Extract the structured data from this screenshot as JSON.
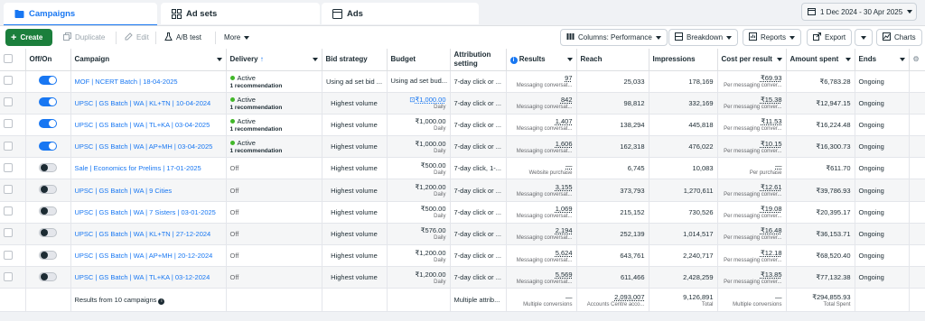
{
  "tabs": [
    {
      "label": "Campaigns",
      "icon": "folder-icon"
    },
    {
      "label": "Ad sets",
      "icon": "grid-icon"
    },
    {
      "label": "Ads",
      "icon": "ad-icon"
    }
  ],
  "date_range": "1 Dec 2024 - 30 Apr 2025",
  "toolbar": {
    "create": "Create",
    "duplicate": "Duplicate",
    "edit": "Edit",
    "ab_test": "A/B test",
    "more": "More",
    "columns": "Columns: Performance",
    "breakdown": "Breakdown",
    "reports": "Reports",
    "export": "Export",
    "charts": "Charts"
  },
  "columns": [
    "Off/On",
    "Campaign",
    "Delivery",
    "Bid strategy",
    "Budget",
    "Attribution setting",
    "Results",
    "Reach",
    "Impressions",
    "Cost per result",
    "Amount spent",
    "Ends"
  ],
  "rows": [
    {
      "on": true,
      "campaign": "MOF | NCERT Batch | 18-04-2025",
      "delivery": "Active",
      "rec": "1 recommendation",
      "bid": "Using ad set bid ...",
      "budget": "Using ad set bud...",
      "budget_sub": "",
      "attr": "7-day click or ...",
      "results": "97",
      "results_sub": "Messaging conversat...",
      "reach": "25,033",
      "impr": "178,169",
      "cpr": "₹69.93",
      "cpr_sub": "Per messaging conver...",
      "spent": "₹6,783.28",
      "ends": "Ongoing"
    },
    {
      "on": true,
      "campaign": "UPSC | GS Batch | WA | KL+TN | 10-04-2024",
      "delivery": "Active",
      "rec": "1 recommendation",
      "bid": "Highest volume",
      "budget": "₹1,000.00",
      "budget_sub": "Daily",
      "attr": "7-day click or ...",
      "results": "842",
      "results_sub": "Messaging conversat...",
      "reach": "98,812",
      "impr": "332,169",
      "cpr": "₹15.38",
      "cpr_sub": "Per messaging conver...",
      "spent": "₹12,947.15",
      "ends": "Ongoing"
    },
    {
      "on": true,
      "campaign": "UPSC | GS Batch | WA | TL+KA | 03-04-2025",
      "delivery": "Active",
      "rec": "1 recommendation",
      "bid": "Highest volume",
      "budget": "₹1,000.00",
      "budget_sub": "Daily",
      "attr": "7-day click or ...",
      "results": "1,407",
      "results_sub": "Messaging conversat...",
      "reach": "138,294",
      "impr": "445,818",
      "cpr": "₹11.53",
      "cpr_sub": "Per messaging conver...",
      "spent": "₹16,224.48",
      "ends": "Ongoing"
    },
    {
      "on": true,
      "campaign": "UPSC | GS Batch | WA | AP+MH | 03-04-2025",
      "delivery": "Active",
      "rec": "1 recommendation",
      "bid": "Highest volume",
      "budget": "₹1,000.00",
      "budget_sub": "Daily",
      "attr": "7-day click or ...",
      "results": "1,606",
      "results_sub": "Messaging conversat...",
      "reach": "162,318",
      "impr": "476,022",
      "cpr": "₹10.15",
      "cpr_sub": "Per messaging conver...",
      "spent": "₹16,300.73",
      "ends": "Ongoing"
    },
    {
      "on": false,
      "campaign": "Sale | Economics for Prelims | 17-01-2025",
      "delivery": "Off",
      "rec": "",
      "bid": "Highest volume",
      "budget": "₹500.00",
      "budget_sub": "Daily",
      "attr": "7-day click, 1-...",
      "results": "—",
      "results_sub": "Website purchase",
      "reach": "6,745",
      "impr": "10,083",
      "cpr": "—",
      "cpr_sub": "Per purchase",
      "spent": "₹611.70",
      "ends": "Ongoing"
    },
    {
      "on": false,
      "campaign": "UPSC | GS Batch | WA | 9 Cities",
      "delivery": "Off",
      "rec": "",
      "bid": "Highest volume",
      "budget": "₹1,200.00",
      "budget_sub": "Daily",
      "attr": "7-day click or ...",
      "results": "3,155",
      "results_sub": "Messaging conversat...",
      "reach": "373,793",
      "impr": "1,270,611",
      "cpr": "₹12.61",
      "cpr_sub": "Per messaging conver...",
      "spent": "₹39,786.93",
      "ends": "Ongoing"
    },
    {
      "on": false,
      "campaign": "UPSC | GS Batch | WA | 7 Sisters | 03-01-2025",
      "delivery": "Off",
      "rec": "",
      "bid": "Highest volume",
      "budget": "₹500.00",
      "budget_sub": "Daily",
      "attr": "7-day click or ...",
      "results": "1,069",
      "results_sub": "Messaging conversat...",
      "reach": "215,152",
      "impr": "730,526",
      "cpr": "₹19.08",
      "cpr_sub": "Per messaging conver...",
      "spent": "₹20,395.17",
      "ends": "Ongoing"
    },
    {
      "on": false,
      "campaign": "UPSC | GS Batch | WA | KL+TN | 27-12-2024",
      "delivery": "Off",
      "rec": "",
      "bid": "Highest volume",
      "budget": "₹576.00",
      "budget_sub": "Daily",
      "attr": "7-day click or ...",
      "results": "2,194",
      "results_sub": "Messaging conversat...",
      "reach": "252,139",
      "impr": "1,014,517",
      "cpr": "₹16.48",
      "cpr_sub": "Per messaging conver...",
      "spent": "₹36,153.71",
      "ends": "Ongoing"
    },
    {
      "on": false,
      "campaign": "UPSC | GS Batch | WA | AP+MH | 20-12-2024",
      "delivery": "Off",
      "rec": "",
      "bid": "Highest volume",
      "budget": "₹1,200.00",
      "budget_sub": "Daily",
      "attr": "7-day click or ...",
      "results": "5,624",
      "results_sub": "Messaging conversat...",
      "reach": "643,761",
      "impr": "2,240,717",
      "cpr": "₹12.18",
      "cpr_sub": "Per messaging conver...",
      "spent": "₹68,520.40",
      "ends": "Ongoing"
    },
    {
      "on": false,
      "campaign": "UPSC | GS Batch | WA | TL+KA | 03-12-2024",
      "delivery": "Off",
      "rec": "",
      "bid": "Highest volume",
      "budget": "₹1,200.00",
      "budget_sub": "Daily",
      "attr": "7-day click or ...",
      "results": "5,569",
      "results_sub": "Messaging conversat...",
      "reach": "611,466",
      "impr": "2,428,259",
      "cpr": "₹13.85",
      "cpr_sub": "Per messaging conver...",
      "spent": "₹77,132.38",
      "ends": "Ongoing"
    }
  ],
  "totals": {
    "label": "Results from 10 campaigns",
    "attr": "Multiple attrib...",
    "results": "—",
    "results_sub": "Multiple conversions",
    "reach": "2,093,007",
    "reach_sub": "Accounts Centre acco...",
    "impr": "9,126,891",
    "impr_sub": "Total",
    "cpr": "—",
    "cpr_sub": "Multiple conversions",
    "spent": "₹294,855.93",
    "spent_sub": "Total Spent"
  },
  "colors": {
    "accent": "#1877f2",
    "create": "#1b7f3c",
    "active": "#42b72a"
  }
}
